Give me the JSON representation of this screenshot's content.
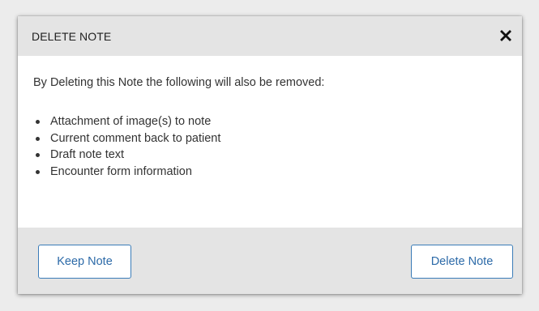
{
  "dialog": {
    "title": "DELETE NOTE",
    "close_icon": "close-x-icon",
    "intro": "By Deleting this Note the following will also be removed:",
    "removed_items": [
      "Attachment of image(s) to note",
      "Current comment back to patient",
      "Draft note text",
      "Encounter form information"
    ],
    "buttons": {
      "keep_label": "Keep Note",
      "delete_label": "Delete Note"
    }
  },
  "colors": {
    "header_bg": "#e4e4e4",
    "footer_bg": "#e4e4e4",
    "button_border": "#3a7cb8",
    "button_text": "#2c6aa8"
  }
}
